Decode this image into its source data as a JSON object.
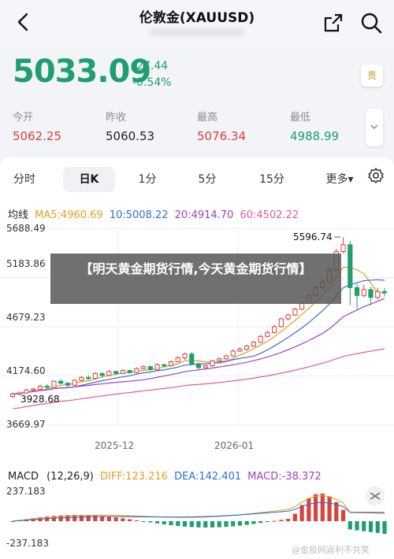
{
  "header": {
    "title": "伦敦金(XAUUSD)"
  },
  "quote": {
    "price": "5033.09",
    "change": "-27.44",
    "change_pct": "-0.54%",
    "tag": "贵"
  },
  "stats": [
    {
      "label": "今开",
      "value": "5062.25",
      "color": "#d8433d"
    },
    {
      "label": "昨收",
      "value": "5060.53",
      "color": "#222222"
    },
    {
      "label": "最高",
      "value": "5076.34",
      "color": "#d8433d"
    },
    {
      "label": "最低",
      "value": "4988.99",
      "color": "#1f9e6f"
    }
  ],
  "tabs": [
    {
      "label": "分时",
      "active": false
    },
    {
      "label": "日K",
      "active": true
    },
    {
      "label": "1分",
      "active": false
    },
    {
      "label": "5分",
      "active": false
    },
    {
      "label": "15分",
      "active": false
    },
    {
      "label": "更多▾",
      "active": false
    }
  ],
  "ma_legend": {
    "title": "均线",
    "ma5": "MA5:4960.69",
    "ma10": "10:5008.22",
    "ma20": "20:4914.70",
    "ma60": "60:4502.22"
  },
  "chart": {
    "y_ticks": [
      "5688.49",
      "5183.86",
      "4679.23",
      "4174.60",
      "3669.97"
    ],
    "x_ticks": [
      "2025-12",
      "2026-01"
    ],
    "high_label": "5596.74",
    "low_label": "3928.68"
  },
  "overlay_text": "【明天黄金期货行情,今天黄金期货行情】",
  "macd": {
    "title": "MACD",
    "params": "(12,26,9)",
    "diff": "DIFF:123.216",
    "dea": "DEA:142.401",
    "macd": "MACD:-38.372",
    "y_top": "237.183",
    "y_bottom": "-237.183"
  },
  "watermark": "@金投网返利不共笑",
  "colors": {
    "up": "#d8433d",
    "down": "#1f9e6f",
    "ma5": "#e0a020",
    "ma10": "#2f6fd1",
    "ma20": "#a040c0",
    "ma60": "#e05a9a"
  },
  "chart_data": {
    "type": "candlestick",
    "y_axis_ticks": [
      5688.49,
      5183.86,
      4679.23,
      4174.6,
      3669.97
    ],
    "x_axis_labels": [
      "2025-12",
      "2026-01"
    ],
    "annotated_high": 5596.74,
    "annotated_low": 3928.68,
    "candles": [
      [
        3965,
        3990,
        3945,
        4005
      ],
      [
        3990,
        4000,
        3975,
        4015
      ],
      [
        4000,
        4030,
        3990,
        4045
      ],
      [
        4030,
        4040,
        4015,
        4055
      ],
      [
        4040,
        4070,
        4030,
        4085
      ],
      [
        4070,
        4060,
        4045,
        4090
      ],
      [
        4060,
        4120,
        4050,
        4130
      ],
      [
        4120,
        4100,
        4085,
        4140
      ],
      [
        4100,
        4080,
        4060,
        4110
      ],
      [
        4080,
        4130,
        4070,
        4140
      ],
      [
        4130,
        4160,
        4120,
        4175
      ],
      [
        4160,
        4150,
        4130,
        4180
      ],
      [
        4150,
        4200,
        4140,
        4215
      ],
      [
        4200,
        4180,
        4165,
        4210
      ],
      [
        4180,
        4220,
        4170,
        4235
      ],
      [
        4220,
        4200,
        4185,
        4230
      ],
      [
        4200,
        4230,
        4190,
        4245
      ],
      [
        4230,
        4210,
        4200,
        4240
      ],
      [
        4210,
        4250,
        4200,
        4265
      ],
      [
        4250,
        4270,
        4240,
        4285
      ],
      [
        4270,
        4240,
        4225,
        4280
      ],
      [
        4240,
        4290,
        4230,
        4305
      ],
      [
        4290,
        4280,
        4265,
        4300
      ],
      [
        4280,
        4320,
        4270,
        4335
      ],
      [
        4320,
        4360,
        4310,
        4375
      ],
      [
        4360,
        4400,
        4340,
        4415
      ],
      [
        4400,
        4300,
        4280,
        4420
      ],
      [
        4300,
        4260,
        4240,
        4310
      ],
      [
        4260,
        4280,
        4245,
        4290
      ],
      [
        4280,
        4330,
        4270,
        4340
      ],
      [
        4330,
        4350,
        4320,
        4365
      ],
      [
        4350,
        4380,
        4340,
        4395
      ],
      [
        4380,
        4430,
        4370,
        4445
      ],
      [
        4430,
        4450,
        4420,
        4470
      ],
      [
        4450,
        4480,
        4430,
        4495
      ],
      [
        4480,
        4520,
        4470,
        4535
      ],
      [
        4520,
        4580,
        4510,
        4595
      ],
      [
        4580,
        4620,
        4570,
        4640
      ],
      [
        4620,
        4680,
        4610,
        4700
      ],
      [
        4680,
        4760,
        4670,
        4775
      ],
      [
        4760,
        4800,
        4740,
        4815
      ],
      [
        4800,
        4860,
        4790,
        4875
      ],
      [
        4860,
        4920,
        4850,
        4935
      ],
      [
        4920,
        5000,
        4910,
        5020
      ],
      [
        5000,
        5080,
        4990,
        5100
      ],
      [
        5080,
        5140,
        5060,
        5160
      ],
      [
        5140,
        5260,
        5120,
        5290
      ],
      [
        5260,
        5450,
        5240,
        5480
      ],
      [
        5450,
        5520,
        5430,
        5597
      ],
      [
        5520,
        5080,
        4900,
        5560
      ],
      [
        5080,
        5000,
        4860,
        5120
      ],
      [
        5000,
        5060,
        4980,
        5110
      ],
      [
        5060,
        4980,
        4900,
        5090
      ],
      [
        4980,
        5040,
        4960,
        5075
      ],
      [
        5040,
        5033,
        4989,
        5076
      ]
    ],
    "macd_series": "histogram bars and DIFF/DEA lines as shown"
  }
}
